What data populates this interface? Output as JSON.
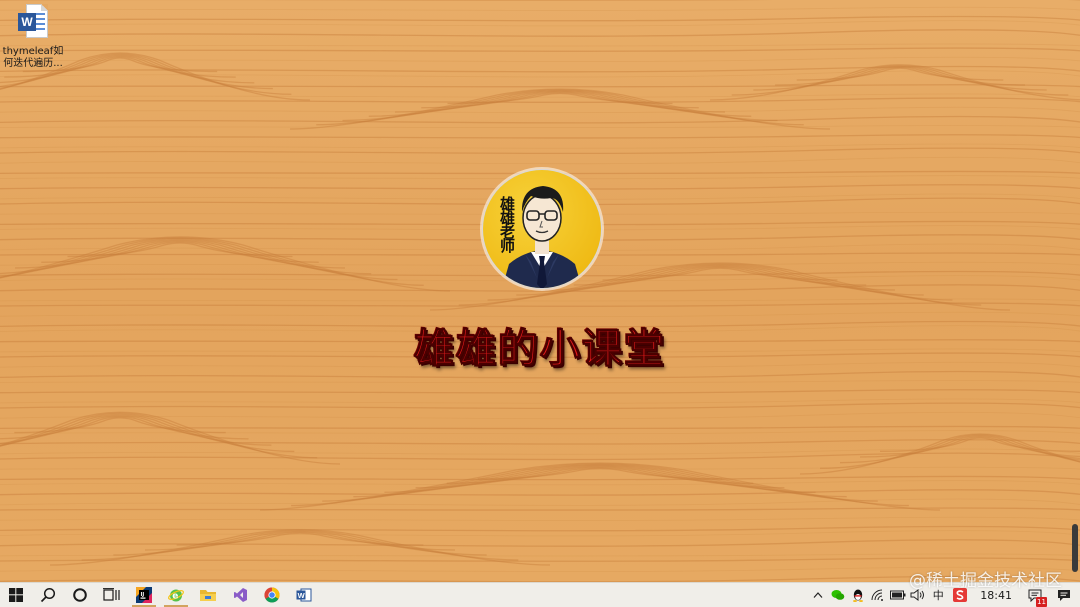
{
  "desktop": {
    "icons": [
      {
        "label": "thymeleaf如何迭代遍历...",
        "app_badge": "W",
        "icon": "word-document-icon"
      }
    ]
  },
  "brand": {
    "avatar_text": "雄雄老师",
    "title": "雄雄的小课堂"
  },
  "watermark": "@稀土掘金技术社区",
  "taskbar": {
    "apps": [
      {
        "name": "start",
        "icon": "windows-start-icon"
      },
      {
        "name": "search",
        "icon": "search-icon"
      },
      {
        "name": "cortana",
        "icon": "cortana-circle-icon"
      },
      {
        "name": "task-view",
        "icon": "task-view-icon"
      },
      {
        "name": "intellij",
        "icon": "intellij-idea-icon",
        "glyph": "IJ"
      },
      {
        "name": "ie",
        "icon": "internet-explorer-icon",
        "glyph": "e"
      },
      {
        "name": "explorer",
        "icon": "file-explorer-icon"
      },
      {
        "name": "visual-studio",
        "icon": "visual-studio-icon"
      },
      {
        "name": "chrome",
        "icon": "chrome-icon"
      },
      {
        "name": "word",
        "icon": "word-icon",
        "glyph": "W"
      }
    ],
    "tray": {
      "ime_label": "中",
      "clock": "18:41",
      "notification_count": "11"
    }
  },
  "colors": {
    "wood_base": "#e5a862",
    "wood_grain": "#c9823f",
    "title_red": "#e21a1a",
    "avatar_yellow": "#f2c21a",
    "taskbar_bg": "#f0eee9",
    "word_blue": "#2b579a"
  }
}
